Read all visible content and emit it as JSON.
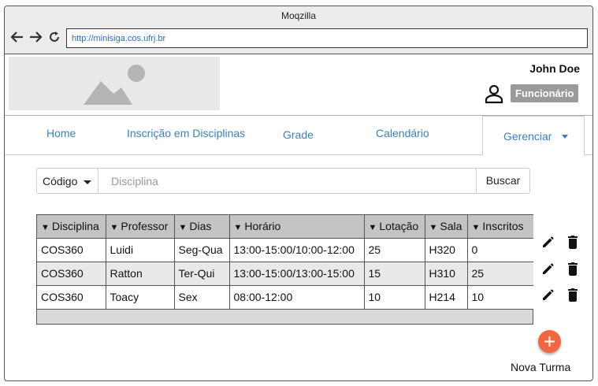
{
  "browser": {
    "title": "Moqzilla",
    "url": "http://minisiga.cos.ufrj.br"
  },
  "header": {
    "user_name": "John Doe",
    "role": "Funcionário"
  },
  "nav": {
    "tabs": [
      {
        "label": "Home"
      },
      {
        "label": "Inscrição em Disciplinas"
      },
      {
        "label": "Grade"
      },
      {
        "label": "Calendário"
      }
    ],
    "active": {
      "label": "Gerenciar"
    }
  },
  "search": {
    "filter": "Código",
    "placeholder": "Disciplina",
    "button": "Buscar"
  },
  "table": {
    "headers": [
      "Disciplina",
      "Professor",
      "Dias",
      "Horário",
      "Lotação",
      "Sala",
      "Inscritos"
    ],
    "rows": [
      [
        "COS360",
        "Luidi",
        "Seg-Qua",
        "13:00-15:00/10:00-12:00",
        "25",
        "H320",
        "0"
      ],
      [
        "COS360",
        "Ratton",
        "Ter-Qui",
        "13:00-15:00/13:00-15:00",
        "15",
        "H310",
        "25"
      ],
      [
        "COS360",
        "Toacy",
        "Sex",
        "08:00-12:00",
        "10",
        "H214",
        "10"
      ]
    ]
  },
  "actions": {
    "add_label": "Nova Turma"
  },
  "icons": {
    "back": "arrow-left-icon",
    "forward": "arrow-right-icon",
    "reload": "reload-icon",
    "user": "user-icon",
    "edit": "pencil-icon",
    "delete": "trash-icon",
    "add": "plus-icon"
  },
  "colors": {
    "link": "#3a7fc1",
    "badge": "#9a9a9a",
    "fab": "#f0673f",
    "url": "#2a6fc9"
  }
}
